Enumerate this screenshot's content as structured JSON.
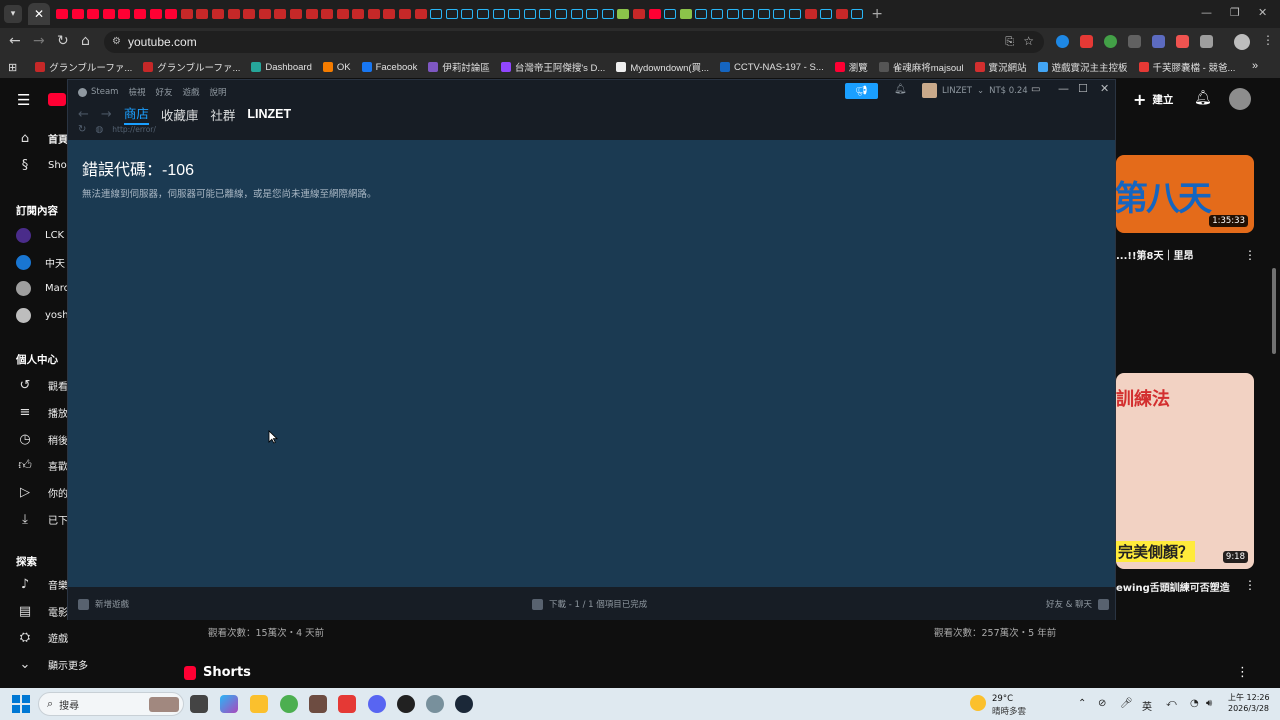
{
  "browser": {
    "address": "youtube.com",
    "bookmarks": [
      {
        "label": "グランブルーファ...",
        "color": "#c62828"
      },
      {
        "label": "グランブルーファ...",
        "color": "#c62828"
      },
      {
        "label": "Dashboard",
        "color": "#26a69a"
      },
      {
        "label": "OK",
        "color": "#f57c00"
      },
      {
        "label": "Facebook",
        "color": "#1877f2"
      },
      {
        "label": "伊莉討論區",
        "color": "#7e57c2"
      },
      {
        "label": "台灣帝王阿傑搜's D...",
        "color": "#9146ff"
      },
      {
        "label": "Mydowndown(買...",
        "color": "#eeeeee"
      },
      {
        "label": "CCTV-NAS-197 - S...",
        "color": "#1565c0"
      },
      {
        "label": "瀏覽",
        "color": "#ff0033"
      },
      {
        "label": "雀魂麻将majsoul",
        "color": "#555555"
      },
      {
        "label": "實況網站",
        "color": "#d32f2f"
      },
      {
        "label": "遊戲實況主主控板",
        "color": "#42a5f5"
      },
      {
        "label": "千芙膠囊檔 - 競爸...",
        "color": "#e53935"
      }
    ]
  },
  "youtube": {
    "sidebar": {
      "home": "首頁",
      "shorts": "Shor",
      "subs_heading": "訂閱內容",
      "subs": [
        {
          "label": "LCK",
          "color": "#4a2c8a"
        },
        {
          "label": "中天",
          "color": "#1976d2"
        },
        {
          "label": "Marc",
          "color": "#9e9e9e"
        },
        {
          "label": "yosh",
          "color": "#bdbdbd"
        }
      ],
      "you_heading": "個人中心",
      "you_items": [
        "觀看",
        "播放",
        "稍後",
        "喜歡",
        "你的",
        "已下"
      ],
      "explore_heading": "探索",
      "explore_items": [
        "音樂",
        "電影",
        "遊戲"
      ],
      "show_more": "顯示更多"
    },
    "create_label": "建立",
    "video1": {
      "duration": "1:35:33",
      "title": "...!!第8天｜里昂",
      "thumb_text": "第八天"
    },
    "video2": {
      "duration": "9:18",
      "title": "ewing舌頭訓練可否塑造",
      "thumb_text1": "訓練法",
      "thumb_text2": "完美側顏？"
    },
    "views_left": "觀看次數：15萬次・4 天前",
    "views_right": "觀看次數：257萬次・5 年前",
    "shorts_heading": "Shorts"
  },
  "steam": {
    "menu": [
      "Steam",
      "檢視",
      "好友",
      "遊戲",
      "說明"
    ],
    "nav": {
      "store": "商店",
      "library": "收藏庫",
      "community": "社群",
      "user": "LINZET"
    },
    "url": "http://error/",
    "user_label": "LINZET",
    "wallet": "NT$ 0.24",
    "error_title": "錯誤代碼：-106",
    "error_message": "無法連線到伺服器，伺服器可能已離線，或是您尚未連線至網際網路。",
    "bottom": {
      "add_game": "新增遊戲",
      "downloads": "下載 - 1 / 1 個項目已完成",
      "friends": "好友 & 聊天"
    }
  },
  "taskbar": {
    "search_placeholder": "搜尋",
    "weather_temp": "29°C",
    "weather_desc": "晴時多雲",
    "ime": "英",
    "time": "上午 12:26",
    "date": "2026/3/28"
  }
}
